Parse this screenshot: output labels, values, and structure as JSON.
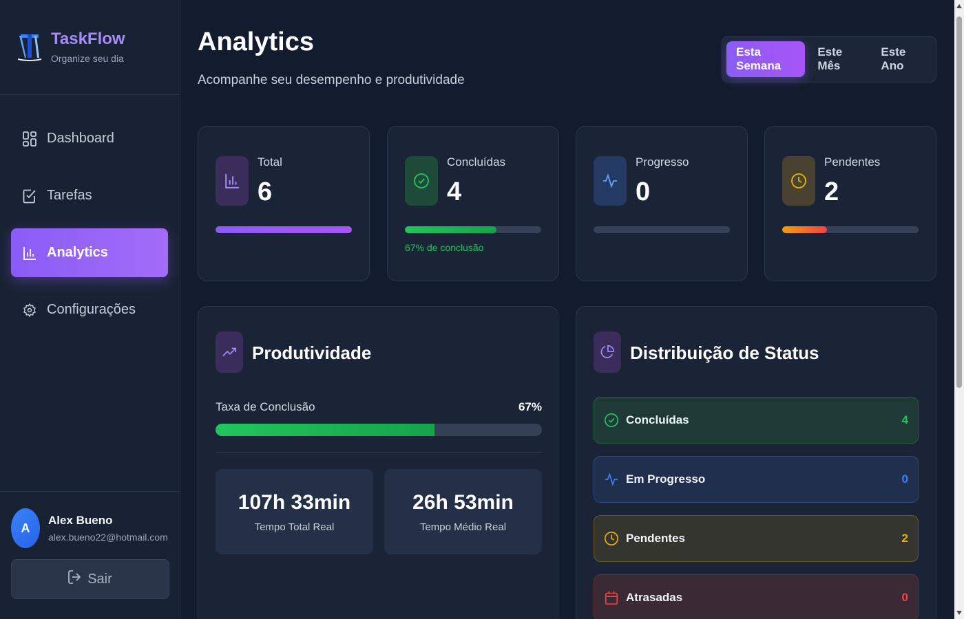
{
  "brand": {
    "title": "TaskFlow",
    "subtitle": "Organize seu dia"
  },
  "nav": [
    {
      "label": "Dashboard",
      "icon": "dashboard-icon",
      "active": false
    },
    {
      "label": "Tarefas",
      "icon": "checkbox-icon",
      "active": false
    },
    {
      "label": "Analytics",
      "icon": "bar-chart-icon",
      "active": true
    },
    {
      "label": "Configurações",
      "icon": "gear-icon",
      "active": false
    }
  ],
  "user": {
    "initial": "A",
    "name": "Alex Bueno",
    "email": "alex.bueno22@hotmail.com"
  },
  "logout_label": "Sair",
  "header": {
    "title": "Analytics",
    "subtitle": "Acompanhe seu desempenho e produtividade"
  },
  "period": {
    "options": [
      "Esta Semana",
      "Este Mês",
      "Este Ano"
    ],
    "selected": "Esta Semana"
  },
  "stats": [
    {
      "label": "Total",
      "value": "6",
      "progress": 1.0,
      "color": "#8b5cf6",
      "icon": "bar-chart-icon",
      "note": ""
    },
    {
      "label": "Concluídas",
      "value": "4",
      "progress": 0.67,
      "color": "#22c55e",
      "icon": "check-circle-icon",
      "note": "67% de conclusão"
    },
    {
      "label": "Progresso",
      "value": "0",
      "progress": 0.0,
      "color": "#3b82f6",
      "icon": "activity-icon",
      "note": ""
    },
    {
      "label": "Pendentes",
      "value": "2",
      "progress": 0.33,
      "color": "#f59e0b",
      "icon": "clock-icon",
      "note": ""
    }
  ],
  "productivity": {
    "title": "Produtividade",
    "rate_label": "Taxa de Conclusão",
    "rate_value": "67%",
    "rate_progress": 0.67,
    "total_time": {
      "value": "107h 33min",
      "label": "Tempo Total Real"
    },
    "avg_time": {
      "value": "26h 53min",
      "label": "Tempo Médio Real"
    }
  },
  "distribution": {
    "title": "Distribuição de Status",
    "items": [
      {
        "label": "Concluídas",
        "count": "4",
        "color": "#22c55e",
        "icon": "check-circle-icon"
      },
      {
        "label": "Em Progresso",
        "count": "0",
        "color": "#3b82f6",
        "icon": "activity-icon"
      },
      {
        "label": "Pendentes",
        "count": "2",
        "color": "#eab308",
        "icon": "clock-icon"
      },
      {
        "label": "Atrasadas",
        "count": "0",
        "color": "#ef4444",
        "icon": "calendar-icon"
      }
    ]
  }
}
